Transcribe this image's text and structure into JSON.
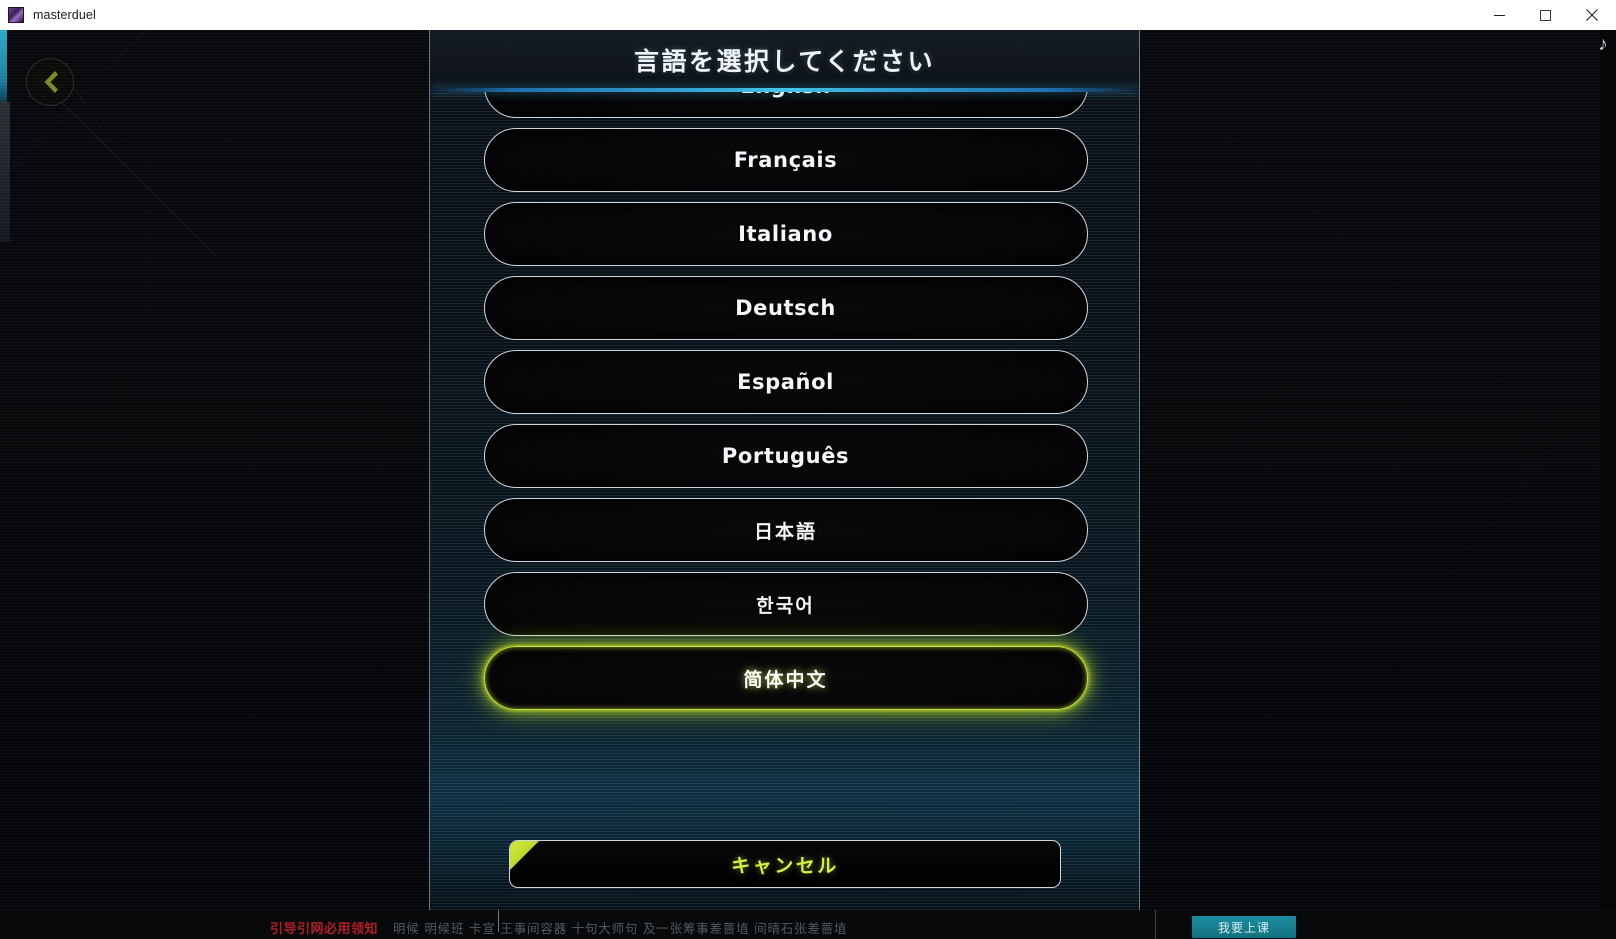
{
  "window": {
    "title": "masterduel",
    "icon": "app-icon",
    "controls": [
      {
        "name": "minimize",
        "glyph": "minimize-icon"
      },
      {
        "name": "maximize",
        "glyph": "maximize-icon"
      },
      {
        "name": "close",
        "glyph": "close-icon"
      }
    ]
  },
  "desktop": {
    "music_note_glyph": "♪"
  },
  "game": {
    "back_button": {
      "icon": "chevron-left-icon",
      "accent_color": "#c2d92c"
    }
  },
  "dialog": {
    "title": "言語を選択してください",
    "accent_line_color": "#46c6e8",
    "languages": [
      {
        "label": "English",
        "selected": false,
        "cjk": false
      },
      {
        "label": "Français",
        "selected": false,
        "cjk": false
      },
      {
        "label": "Italiano",
        "selected": false,
        "cjk": false
      },
      {
        "label": "Deutsch",
        "selected": false,
        "cjk": false
      },
      {
        "label": "Español",
        "selected": false,
        "cjk": false
      },
      {
        "label": "Português",
        "selected": false,
        "cjk": false
      },
      {
        "label": "日本語",
        "selected": false,
        "cjk": true
      },
      {
        "label": "한국어",
        "selected": false,
        "cjk": true
      },
      {
        "label": "简体中文",
        "selected": true,
        "cjk": true
      }
    ],
    "selected_language": "简体中文",
    "selected_highlight_color": "#c8e233",
    "cancel": {
      "label": "キャンセル",
      "color": "#d8f03c"
    },
    "scrollbar": {
      "thumb_color": "#eef1f4",
      "position": "bottom"
    }
  },
  "bottom_strip": {
    "red_text": "引导引网必用领知",
    "body_text": "明候 明候班 卡宣 王事间容器 十句大师句 及一张筹事差蔷埴 间晴石张差蔷埴",
    "teal_button_label": "我要上课"
  }
}
